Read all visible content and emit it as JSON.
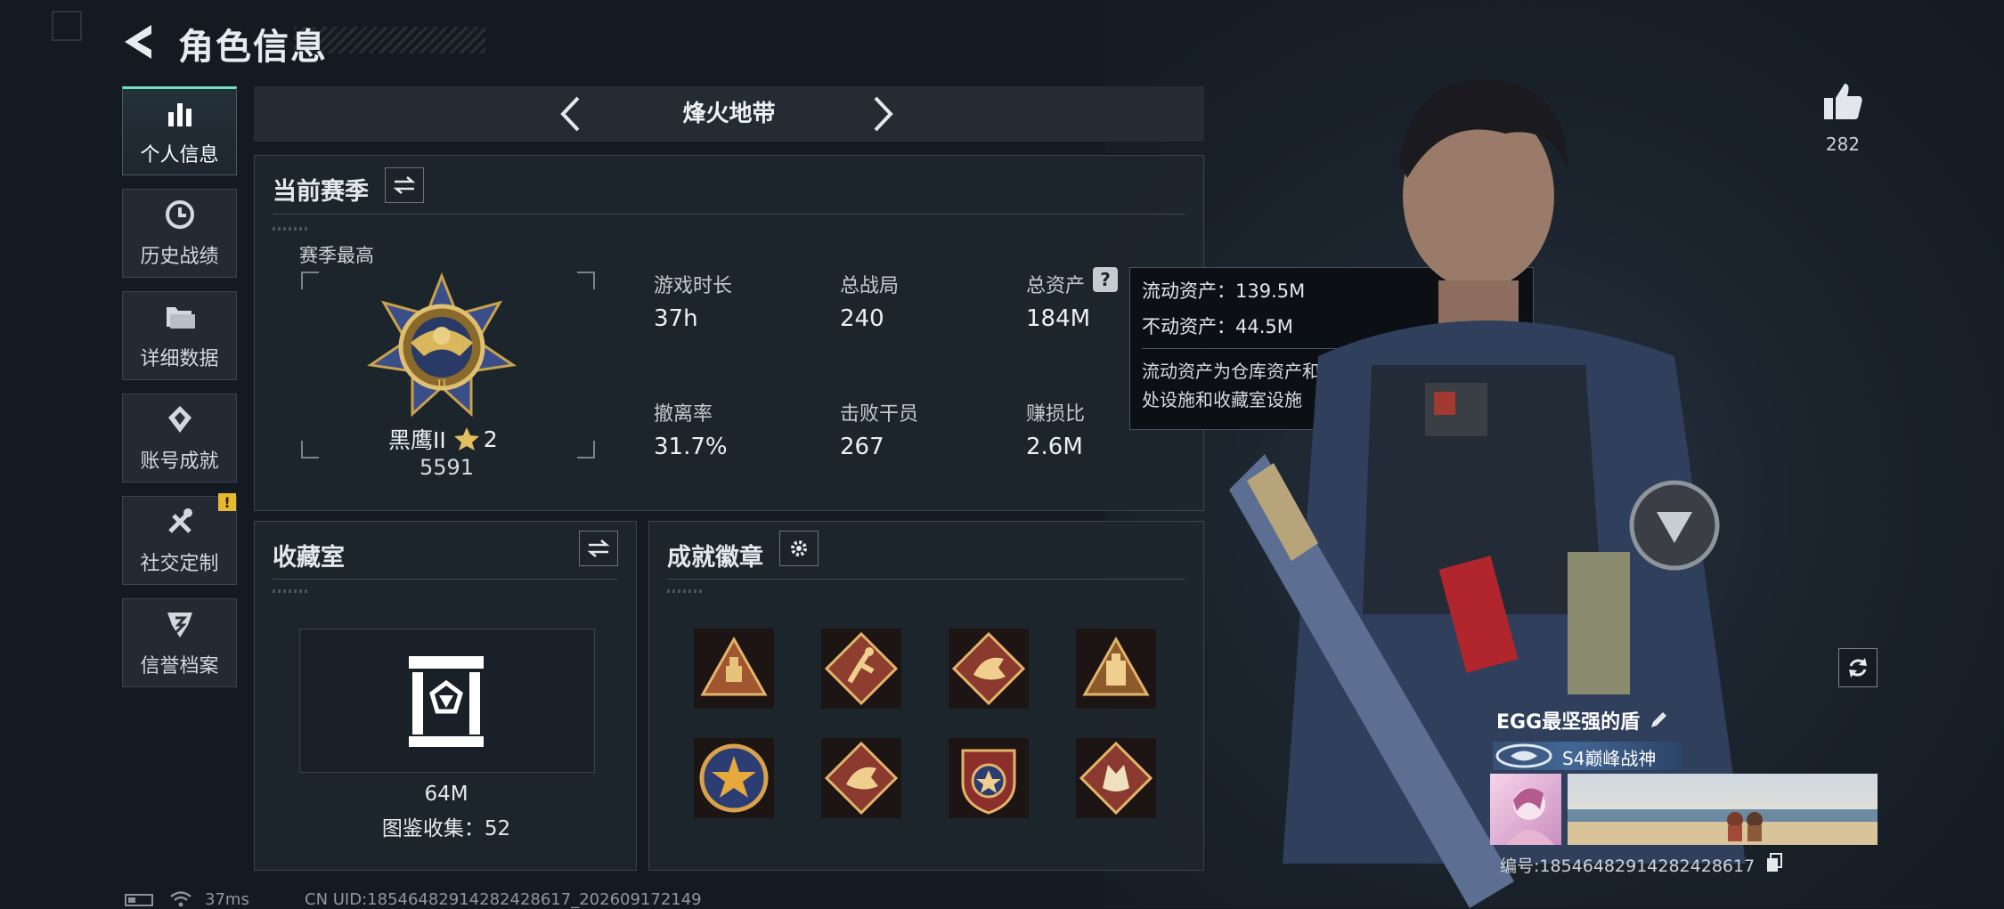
{
  "header": {
    "title": "角色信息"
  },
  "sidebar": {
    "items": [
      {
        "label": "个人信息",
        "icon": "bar-chart-icon",
        "active": true
      },
      {
        "label": "历史战绩",
        "icon": "history-icon"
      },
      {
        "label": "详细数据",
        "icon": "folder-icon"
      },
      {
        "label": "账号成就",
        "icon": "achievement-icon"
      },
      {
        "label": "社交定制",
        "icon": "tools-icon",
        "badge": "!"
      },
      {
        "label": "信誉档案",
        "icon": "credibility-icon"
      }
    ]
  },
  "mode_switch": {
    "current": "烽火地带"
  },
  "season": {
    "heading": "当前赛季",
    "best_label": "赛季最高",
    "rank_name": "黑鹰II",
    "rank_stars": "2",
    "rank_score": "5591",
    "stats": [
      {
        "label": "游戏时长",
        "value": "37h"
      },
      {
        "label": "总战局",
        "value": "240"
      },
      {
        "label": "总资产",
        "value": "184M"
      },
      {
        "label": "撤离率",
        "value": "31.7%"
      },
      {
        "label": "击败干员",
        "value": "267"
      },
      {
        "label": "赚损比",
        "value": "2.6M"
      }
    ]
  },
  "assets_tooltip": {
    "help_mark": "?",
    "liquid": "流动资产：139.5M",
    "fixed": "不动资产：44.5M",
    "note": "流动资产为仓库资产和哈夫币，不动资产为特勤处设施和收藏室设施"
  },
  "collection": {
    "heading": "收藏室",
    "value": "64M",
    "catalog": "图鉴收集：52"
  },
  "achievements": {
    "heading": "成就徽章",
    "badges": [
      "warning-triangle-badge",
      "runner-diamond-badge",
      "dragon-diamond-badge",
      "tower-triangle-badge",
      "star-medal-badge",
      "dragon-diamond-badge",
      "crest-shield-badge",
      "wolf-diamond-badge"
    ]
  },
  "profile": {
    "likes": "282",
    "player_name": "EGG最坚强的盾",
    "title": "S4巅峰战神",
    "player_id": "编号:18546482914282428617"
  },
  "status_bar": {
    "ping": "37ms",
    "uid": "CN UID:18546482914282428617_202609172149"
  },
  "colors": {
    "accent": "#6ee0c0",
    "warning": "#e8b82e",
    "panel_bg": "#1e252d",
    "page_bg": "#141a21"
  }
}
